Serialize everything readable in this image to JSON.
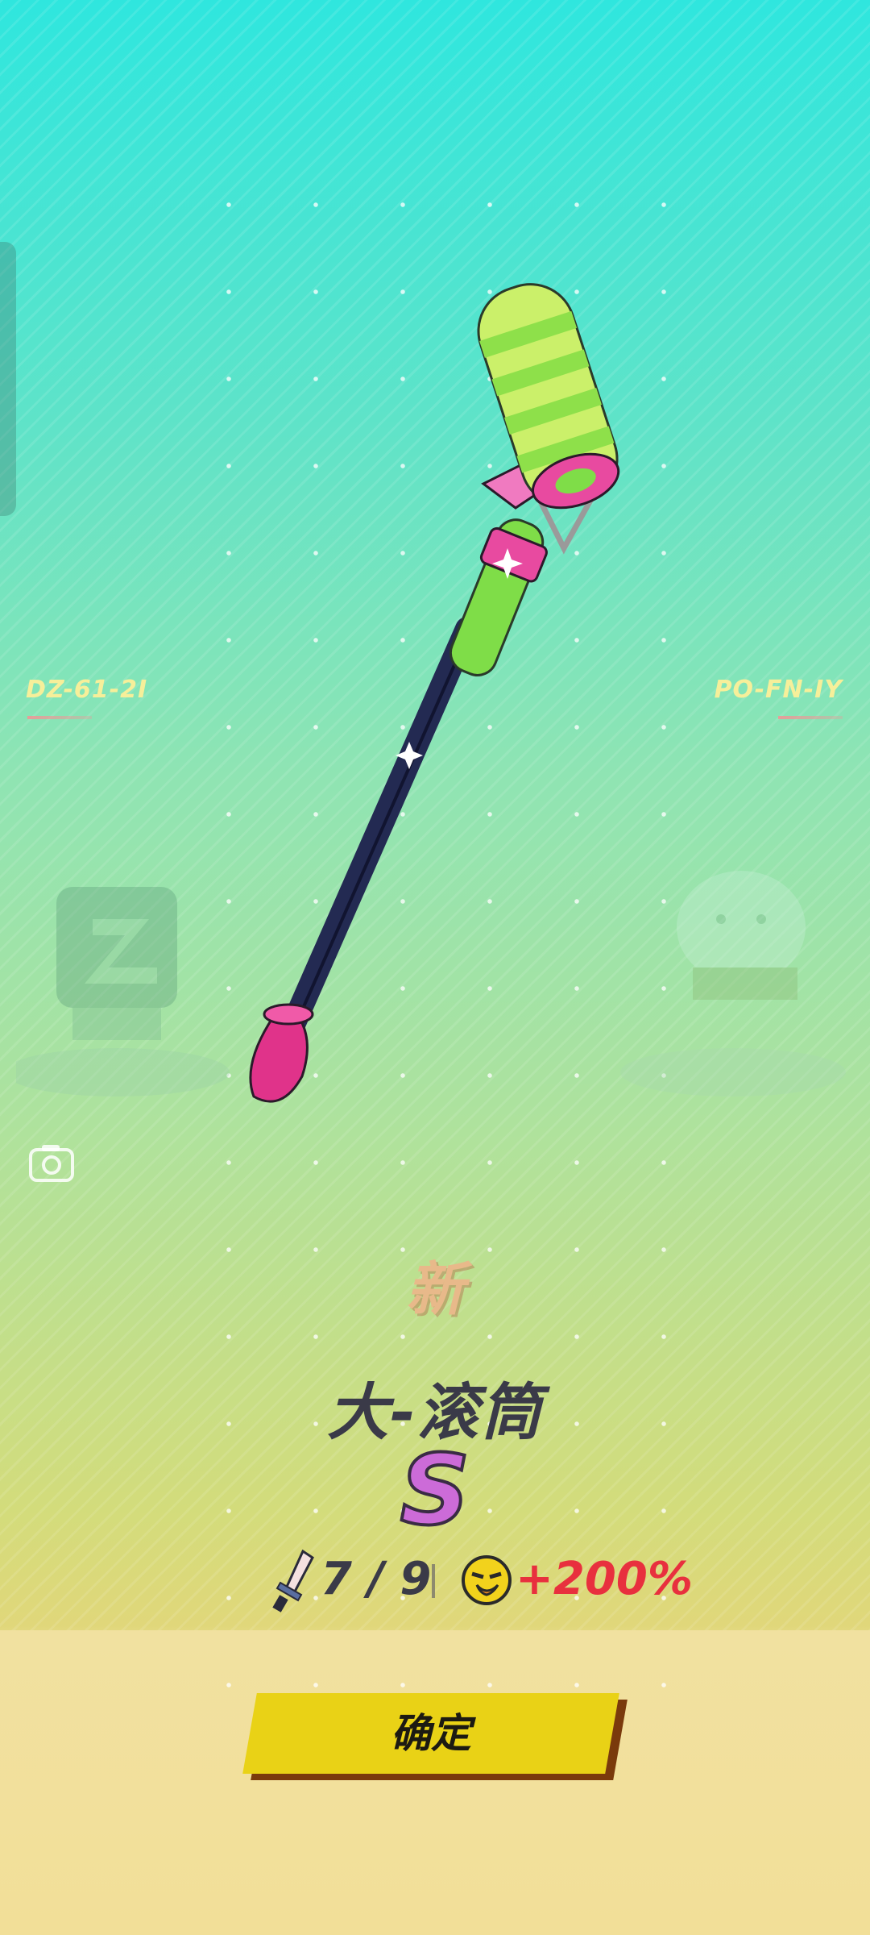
{
  "codes": {
    "left": "DZ-61-2I",
    "right": "PO-FN-IY"
  },
  "badge": {
    "new_label": "新"
  },
  "item": {
    "name": "大-滚筒",
    "rank": "S"
  },
  "stats": {
    "weapon_count": "7 / 9",
    "bonus": "+200%"
  },
  "actions": {
    "confirm_label": "确定"
  },
  "icons": {
    "camera": "camera-icon",
    "sword": "sword-icon",
    "bonus": "duck-face-icon",
    "weapon": "paint-roller-icon"
  },
  "colors": {
    "accent_yellow": "#e9d216",
    "rank_purple": "#cc6bd8",
    "bonus_red": "#e8303e",
    "name_dark": "#3a3a48"
  }
}
